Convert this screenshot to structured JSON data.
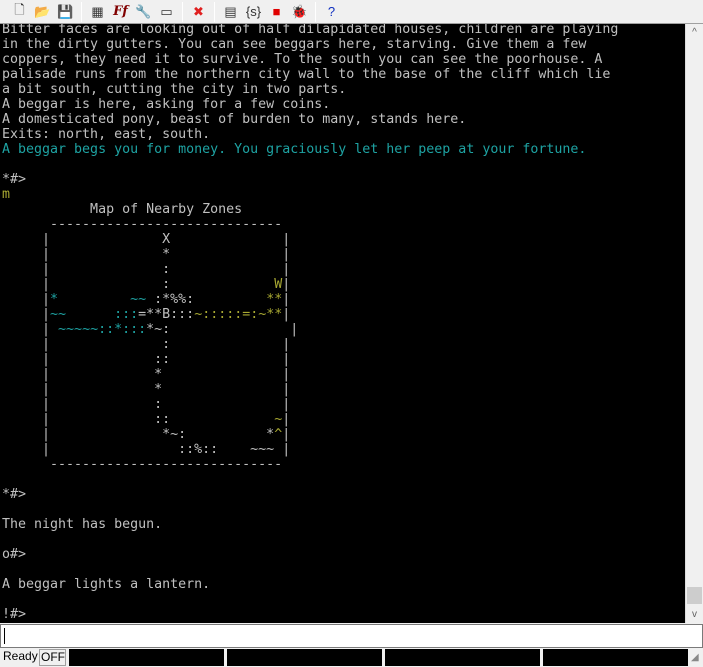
{
  "toolbar": {
    "buttons": [
      {
        "name": "new-file-icon",
        "glyph": "🗋"
      },
      {
        "name": "open-folder-icon",
        "glyph": "📂"
      },
      {
        "name": "save-icon",
        "glyph": "💾"
      },
      {
        "sep": true
      },
      {
        "name": "colors-icon",
        "glyph": "▦"
      },
      {
        "name": "font-icon",
        "glyph": "Ff"
      },
      {
        "name": "wrench-icon",
        "glyph": "🔧"
      },
      {
        "name": "window-icon",
        "glyph": "▭"
      },
      {
        "sep": true
      },
      {
        "name": "disconnect-icon",
        "glyph": "✖"
      },
      {
        "sep": true
      },
      {
        "name": "terminal-icon",
        "glyph": "▤"
      },
      {
        "name": "script-icon",
        "glyph": "{s}"
      },
      {
        "name": "stop-icon",
        "glyph": "■"
      },
      {
        "name": "bug-icon",
        "glyph": "🐞"
      },
      {
        "sep": true
      },
      {
        "name": "help-icon",
        "glyph": "?"
      }
    ]
  },
  "colors": {
    "default": "#c0c0c0",
    "teal": "#1ea3a3",
    "yellow": "#a8a832",
    "background": "#000000"
  },
  "output": {
    "lines": [
      [
        {
          "t": "Bitter faces are looking out of half dilapidated houses, children are playing"
        }
      ],
      [
        {
          "t": "in the dirty gutters. You can see beggars here, starving. Give them a few"
        }
      ],
      [
        {
          "t": "coppers, they need it to survive. To the south you can see the poorhouse. A"
        }
      ],
      [
        {
          "t": "palisade runs from the northern city wall to the base of the cliff which lie"
        }
      ],
      [
        {
          "t": "a bit south, cutting the city in two parts."
        }
      ],
      [
        {
          "t": "A beggar is here, asking for a few coins."
        }
      ],
      [
        {
          "t": "A domesticated pony, beast of burden to many, stands here."
        }
      ],
      [
        {
          "t": "Exits: north, east, south."
        }
      ],
      [
        {
          "t": "A beggar begs you for money. You graciously let her peep at your fortune.",
          "c": "teal"
        }
      ],
      [],
      [
        {
          "t": "*#>"
        }
      ],
      [
        {
          "t": "m",
          "c": "yellow"
        }
      ],
      [
        {
          "t": "           Map of Nearby Zones"
        }
      ],
      [
        {
          "t": "      -----------------------------"
        }
      ],
      [
        {
          "t": "     |              X              |"
        }
      ],
      [
        {
          "t": "     |              *              |"
        }
      ],
      [
        {
          "t": "     |              :              |"
        }
      ],
      [
        {
          "t": "     |              :             "
        },
        {
          "t": "W",
          "c": "yellow"
        },
        {
          "t": "|"
        }
      ],
      [
        {
          "t": "     |"
        },
        {
          "t": "*",
          "c": "teal"
        },
        {
          "t": "         "
        },
        {
          "t": "~~",
          "c": "teal"
        },
        {
          "t": " :*%%:         "
        },
        {
          "t": "**",
          "c": "yellow"
        },
        {
          "t": "|"
        }
      ],
      [
        {
          "t": "     |"
        },
        {
          "t": "~~",
          "c": "teal"
        },
        {
          "t": "      "
        },
        {
          "t": ":::",
          "c": "teal"
        },
        {
          "t": "=**B:::"
        },
        {
          "t": "~:::::=:~**",
          "c": "yellow"
        },
        {
          "t": "|"
        }
      ],
      [
        {
          "t": "     | "
        },
        {
          "t": "~~~~~::*:::",
          "c": "teal"
        },
        {
          "t": "*~:"
        },
        {
          "t": "               |"
        }
      ],
      [
        {
          "t": "     |              :              |"
        }
      ],
      [
        {
          "t": "     |             ::              |"
        }
      ],
      [
        {
          "t": "     |             *               |"
        }
      ],
      [
        {
          "t": "     |             *               |"
        }
      ],
      [
        {
          "t": "     |             :               |"
        }
      ],
      [
        {
          "t": "     |             ::             "
        },
        {
          "t": "~",
          "c": "yellow"
        },
        {
          "t": "|"
        }
      ],
      [
        {
          "t": "     |              *~:          *"
        },
        {
          "t": "^",
          "c": "yellow"
        },
        {
          "t": "|"
        }
      ],
      [
        {
          "t": "     |                ::%::    ~~~ |"
        }
      ],
      [
        {
          "t": "      -----------------------------"
        }
      ],
      [],
      [
        {
          "t": "*#>"
        }
      ],
      [],
      [
        {
          "t": "The night has begun."
        }
      ],
      [],
      [
        {
          "t": "o#>"
        }
      ],
      [],
      [
        {
          "t": "A beggar lights a lantern."
        }
      ],
      [],
      [
        {
          "t": "!#>"
        }
      ]
    ]
  },
  "scrollbar": {
    "up": "^",
    "down": "v",
    "position_percent": 97
  },
  "input": {
    "value": ""
  },
  "status": {
    "ready": "Ready",
    "mode": "OFF"
  }
}
